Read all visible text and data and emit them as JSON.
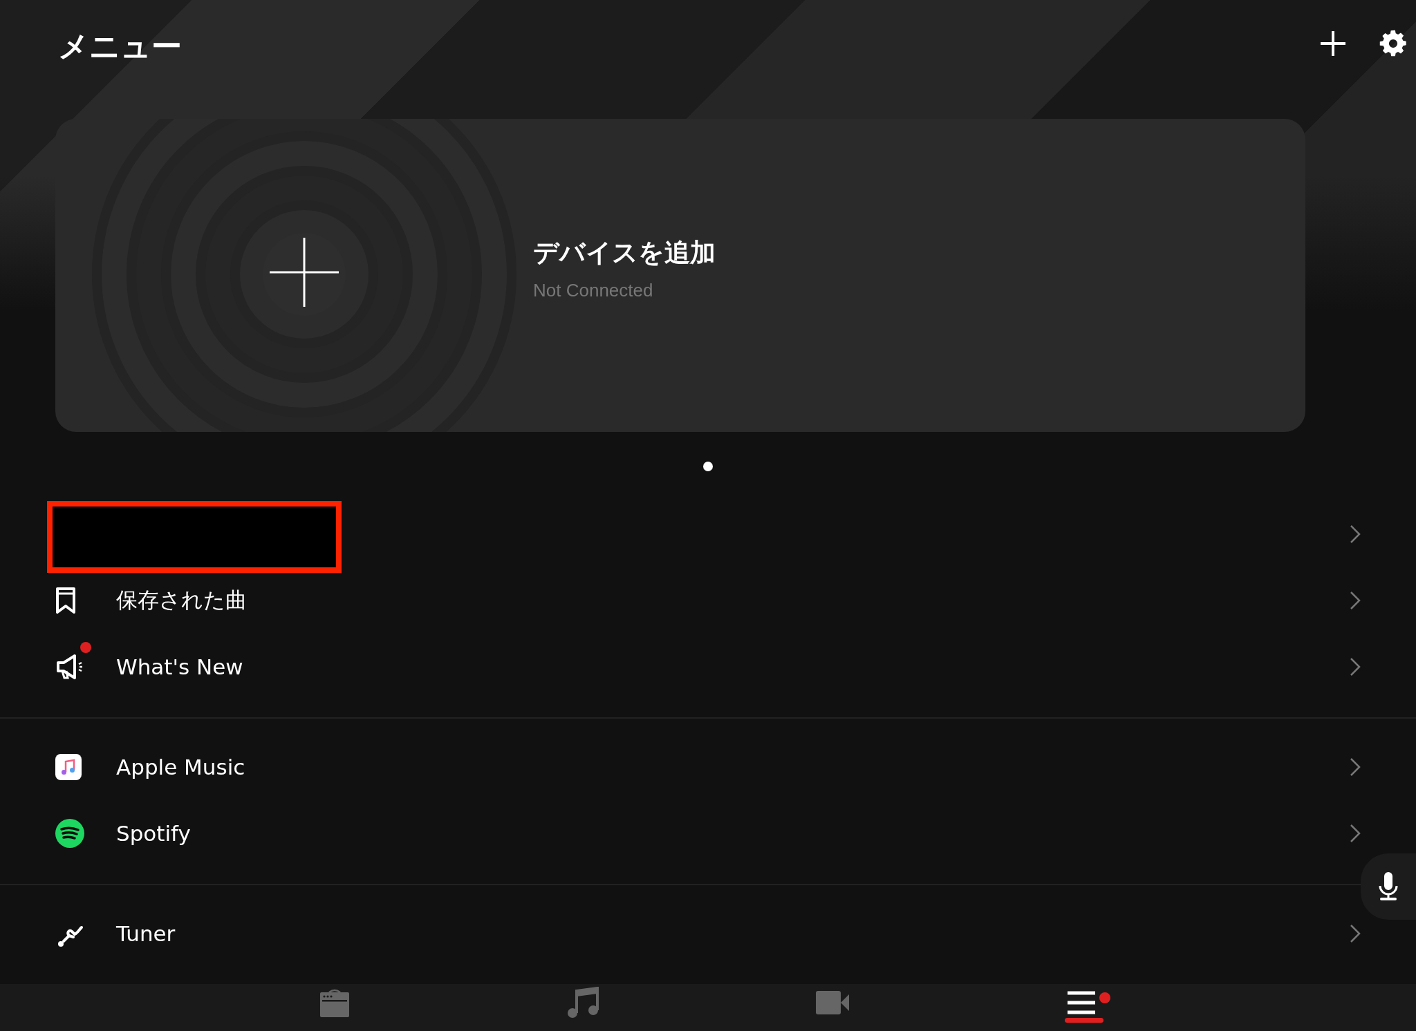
{
  "header": {
    "title": "メニュー"
  },
  "device_card": {
    "title": "デバイスを追加",
    "status": "Not Connected"
  },
  "pager": [
    {
      "selected": true
    }
  ],
  "menu_sections": [
    [
      {
        "kind": "redacted",
        "badge": false
      },
      {
        "kind": "bookmark",
        "label": "保存された曲",
        "badge": false
      },
      {
        "kind": "megaphone",
        "label": "What's New",
        "badge": true
      }
    ],
    [
      {
        "kind": "apple-music",
        "label": "Apple Music",
        "badge": false
      },
      {
        "kind": "spotify",
        "label": "Spotify",
        "badge": false
      }
    ],
    [
      {
        "kind": "tuner",
        "label": "Tuner",
        "badge": false
      }
    ]
  ],
  "bottom_nav": [
    {
      "kind": "amp",
      "selected": false,
      "badge": false
    },
    {
      "kind": "music",
      "selected": false,
      "badge": false
    },
    {
      "kind": "video",
      "selected": false,
      "badge": false
    },
    {
      "kind": "menu",
      "selected": true,
      "badge": true
    }
  ]
}
